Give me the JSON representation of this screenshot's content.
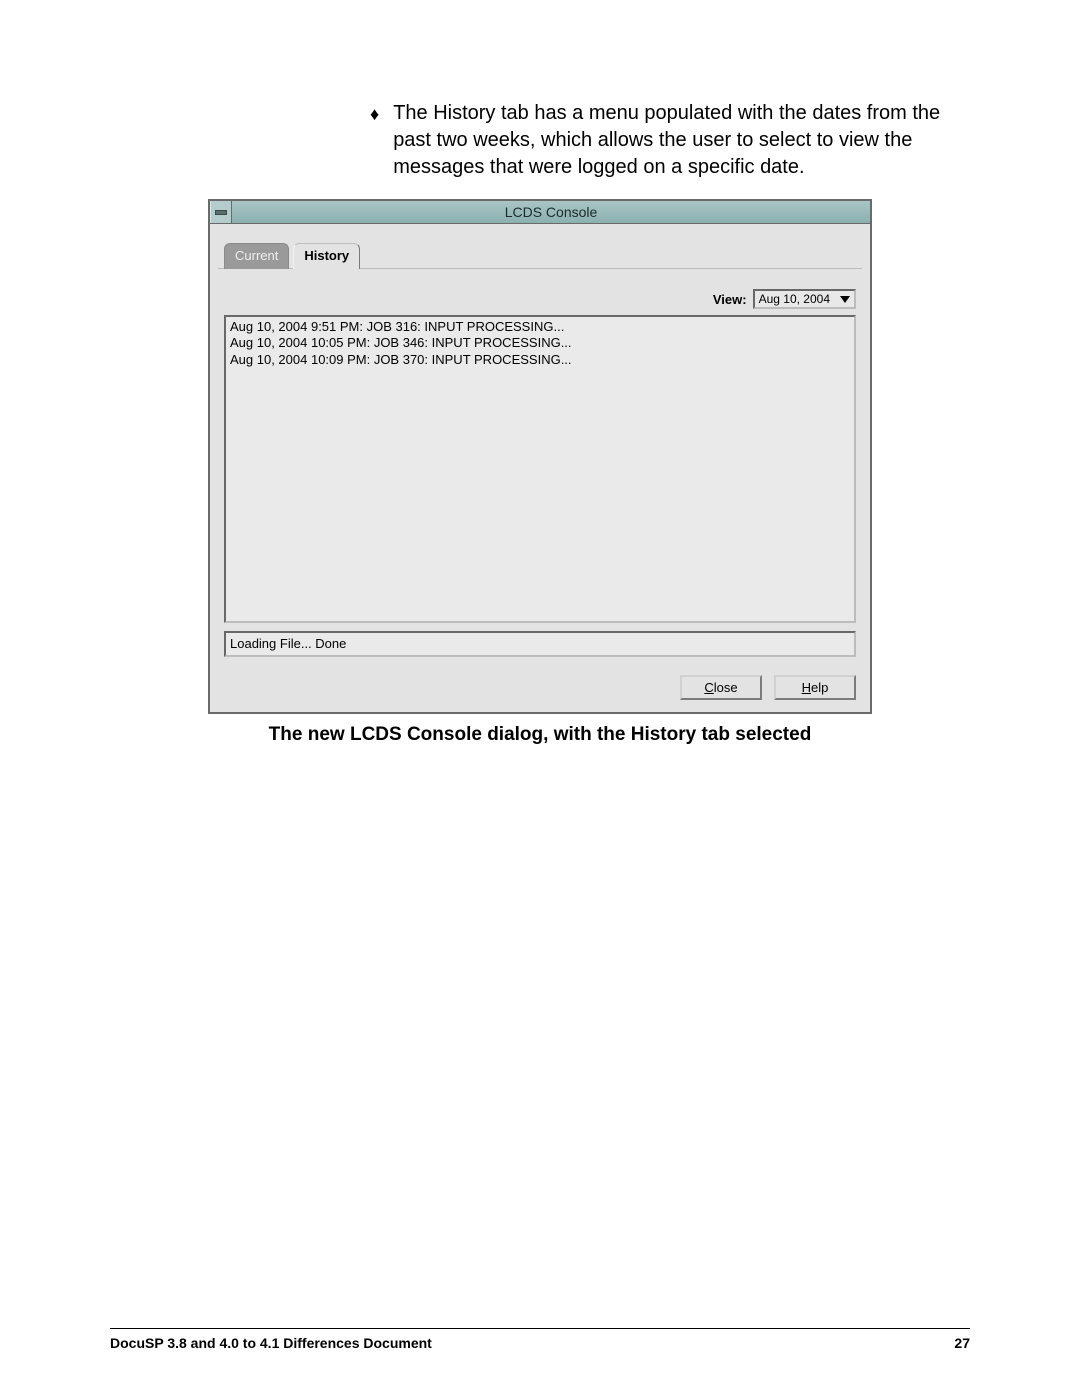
{
  "paragraph": {
    "bullet_text": "The History tab has a menu populated with the dates from the past two weeks, which allows the user to select to view the messages that were logged on a specific date."
  },
  "window": {
    "title": "LCDS Console",
    "tabs": {
      "current": "Current",
      "history": "History"
    },
    "view_label": "View:",
    "view_selected": "Aug 10, 2004",
    "log_lines": [
      "Aug 10, 2004 9:51 PM:   JOB 316: INPUT PROCESSING...",
      "Aug 10, 2004 10:05 PM:   JOB 346: INPUT PROCESSING...",
      "Aug 10, 2004 10:09 PM:   JOB 370: INPUT PROCESSING..."
    ],
    "status": "Loading File... Done",
    "buttons": {
      "close": "Close",
      "help": "Help"
    }
  },
  "caption": "The new LCDS Console dialog, with the History tab selected",
  "footer": {
    "left": "DocuSP 3.8 and 4.0 to 4.1 Differences Document",
    "right": "27"
  }
}
